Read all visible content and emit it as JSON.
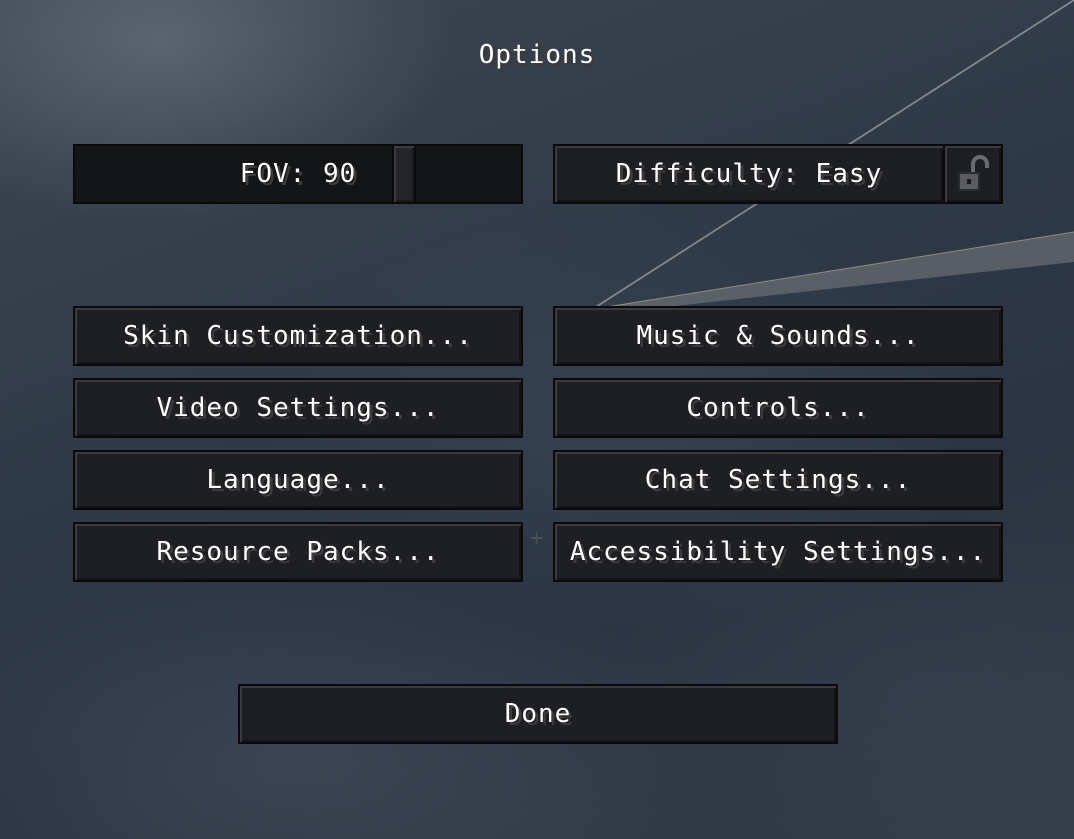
{
  "screen": {
    "title": "Options"
  },
  "fov_slider": {
    "label": "FOV: 90",
    "value": 90,
    "min": 30,
    "max": 110
  },
  "difficulty": {
    "label": "Difficulty: Easy",
    "lock_state": "unlocked",
    "lock_icon": "unlocked-padlock-icon"
  },
  "menu": {
    "skin_customization": "Skin Customization...",
    "music_sounds": "Music & Sounds...",
    "video_settings": "Video Settings...",
    "controls": "Controls...",
    "language": "Language...",
    "chat_settings": "Chat Settings...",
    "resource_packs": "Resource Packs...",
    "accessibility_settings": "Accessibility Settings..."
  },
  "done_label": "Done",
  "colors": {
    "button_bg": "#1e1f22",
    "text": "#ffffff",
    "text_shadow": "#3b3b3b"
  }
}
